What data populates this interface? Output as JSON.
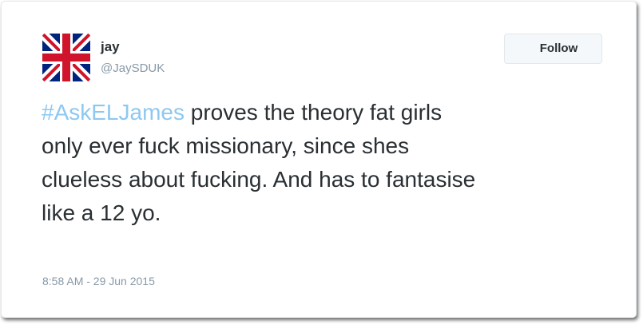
{
  "author": {
    "display_name": "jay",
    "handle": "@JaySDUK",
    "avatar_icon": "union-jack-flag-icon"
  },
  "follow_button": {
    "label": "Follow"
  },
  "tweet": {
    "hashtag": "#AskELJames",
    "line1_rest": " proves the theory fat girls",
    "line2": "only ever fuck missionary, since shes",
    "line3": "clueless about fucking. And has to fantasise",
    "line4": "like a 12 yo."
  },
  "timestamp": "8:58 AM - 29 Jun 2015",
  "colors": {
    "hashtag": "#8ec8f0",
    "text": "#292f33",
    "muted": "#8899a6",
    "flag_blue": "#00247d",
    "flag_red": "#cf142b"
  }
}
